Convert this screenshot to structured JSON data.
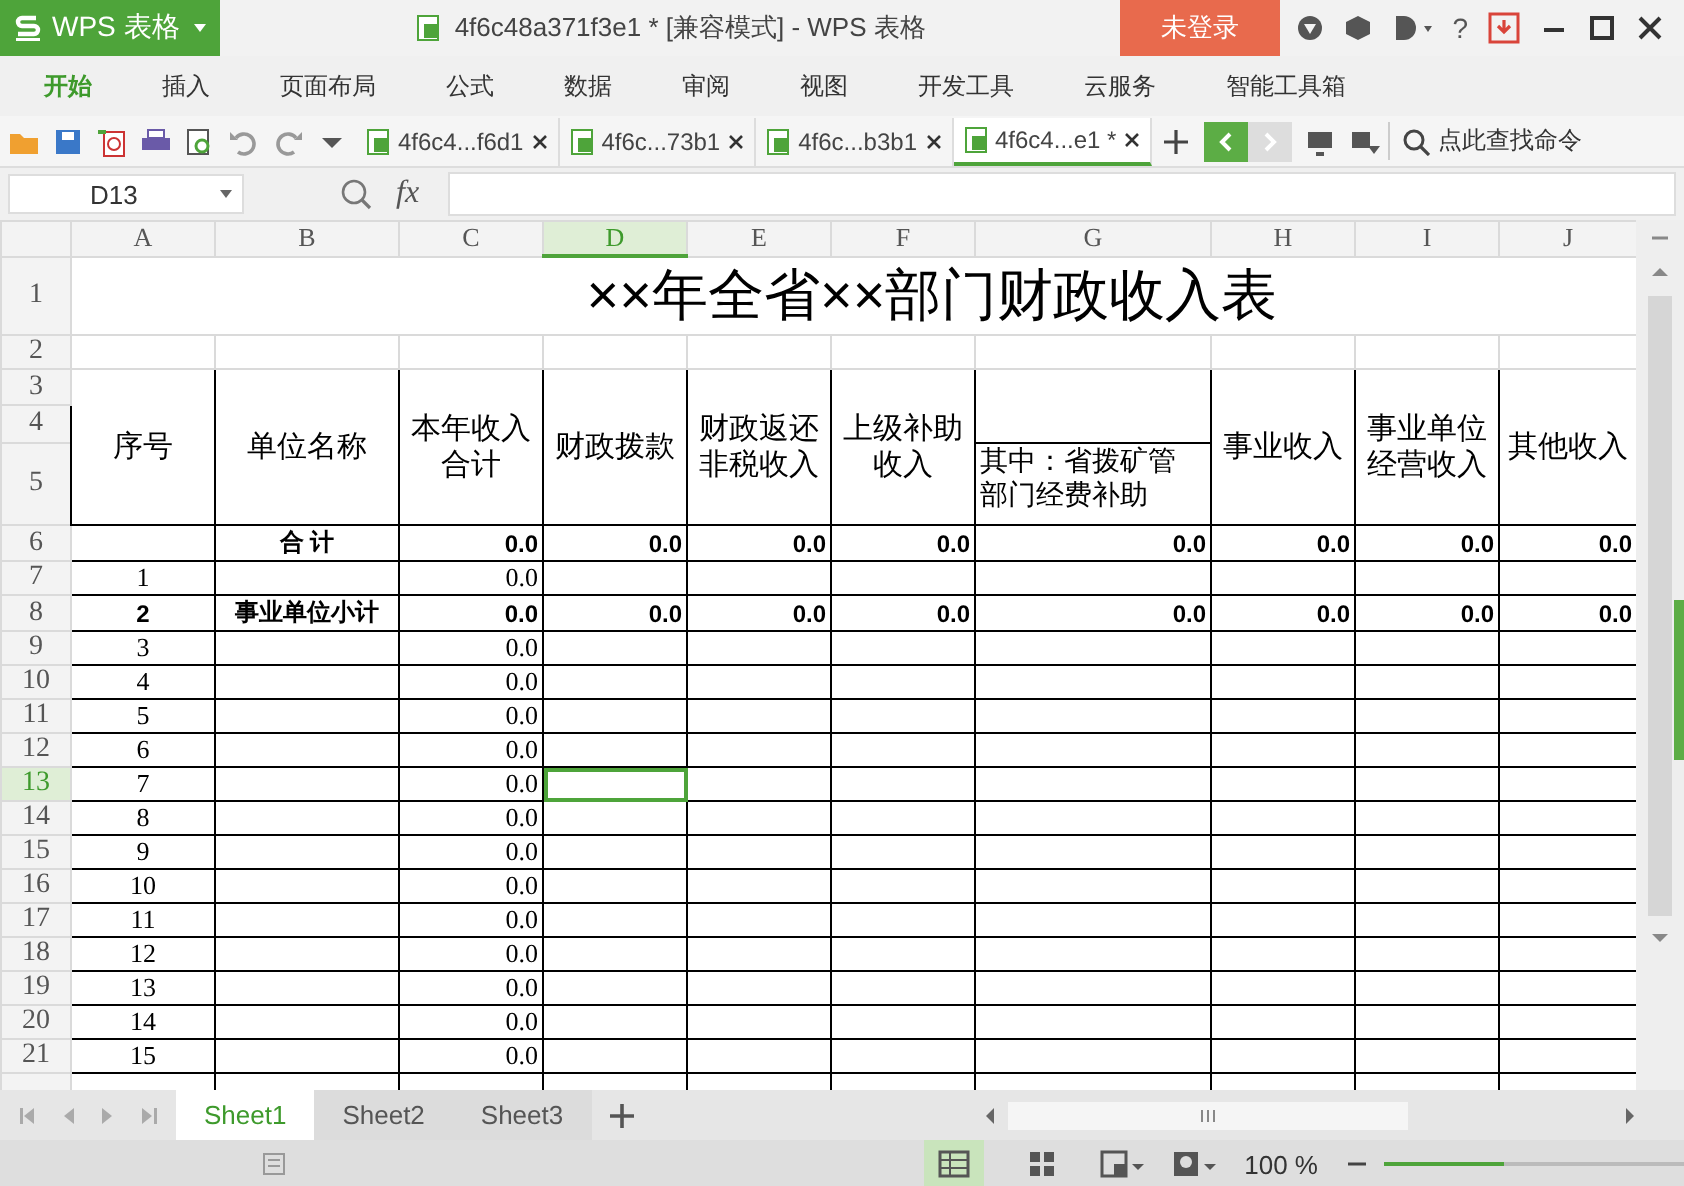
{
  "title_bar": {
    "app_button": "WPS 表格",
    "document_title": "4f6c48a371f3e1 * [兼容模式] - WPS 表格",
    "login_button": "未登录",
    "help": "?"
  },
  "menu": {
    "items": [
      {
        "label": "开始",
        "selected": true
      },
      {
        "label": "插入",
        "selected": false
      },
      {
        "label": "页面布局",
        "selected": false
      },
      {
        "label": "公式",
        "selected": false
      },
      {
        "label": "数据",
        "selected": false
      },
      {
        "label": "审阅",
        "selected": false
      },
      {
        "label": "视图",
        "selected": false
      },
      {
        "label": "开发工具",
        "selected": false
      },
      {
        "label": "云服务",
        "selected": false
      },
      {
        "label": "智能工具箱",
        "selected": false
      }
    ]
  },
  "toolbar": {
    "doc_tabs": [
      {
        "label": "4f6c4...f6d1",
        "selected": false
      },
      {
        "label": "4f6c...73b1",
        "selected": false
      },
      {
        "label": "4f6c...b3b1",
        "selected": false
      },
      {
        "label": "4f6c4...e1 *",
        "selected": true
      }
    ],
    "search": "点此查找命令"
  },
  "formula_bar": {
    "name_box": "D13",
    "fx": "fx"
  },
  "sheet": {
    "title": "××年全省××部门财政收入表",
    "columns": [
      {
        "label": "A",
        "selected": false
      },
      {
        "label": "B",
        "selected": false
      },
      {
        "label": "C",
        "selected": false
      },
      {
        "label": "D",
        "selected": true
      },
      {
        "label": "E",
        "selected": false
      },
      {
        "label": "F",
        "selected": false
      },
      {
        "label": "G",
        "selected": false
      },
      {
        "label": "H",
        "selected": false
      },
      {
        "label": "I",
        "selected": false
      },
      {
        "label": "J",
        "selected": false
      }
    ],
    "header_cells": [
      {
        "kind": "merged",
        "lines": [
          "序号"
        ]
      },
      {
        "kind": "merged",
        "lines": [
          "单位名称"
        ]
      },
      {
        "kind": "merged",
        "lines": [
          "本年收入",
          "合计"
        ]
      },
      {
        "kind": "merged",
        "lines": [
          "财政拨款"
        ]
      },
      {
        "kind": "merged",
        "lines": [
          "财政返还",
          "非税收入"
        ]
      },
      {
        "kind": "merged",
        "lines": [
          "上级补助",
          "收入"
        ]
      },
      {
        "kind": "split",
        "lines": [
          "其中：省拨矿管",
          "部门经费补助"
        ]
      },
      {
        "kind": "merged",
        "lines": [
          "事业收入"
        ]
      },
      {
        "kind": "merged",
        "lines": [
          "事业单位",
          "经营收入"
        ]
      },
      {
        "kind": "merged",
        "lines": [
          "其他收入"
        ]
      }
    ],
    "rows": [
      {
        "label": "1",
        "selected": false
      },
      {
        "label": "2",
        "selected": false
      },
      {
        "label": "3",
        "selected": false
      },
      {
        "label": "4",
        "selected": false
      },
      {
        "label": "5",
        "selected": false
      },
      {
        "label": "6",
        "selected": false,
        "bold": true,
        "cells": [
          null,
          "合 计",
          "0.0",
          "0.0",
          "0.0",
          "0.0",
          "0.0",
          "0.0",
          "0.0",
          "0.0"
        ]
      },
      {
        "label": "7",
        "selected": false,
        "bold": false,
        "cells": [
          "1",
          null,
          "0.0",
          null,
          null,
          null,
          null,
          null,
          null,
          null
        ]
      },
      {
        "label": "8",
        "selected": false,
        "bold": true,
        "cells": [
          "2",
          "事业单位小计",
          "0.0",
          "0.0",
          "0.0",
          "0.0",
          "0.0",
          "0.0",
          "0.0",
          "0.0"
        ]
      },
      {
        "label": "9",
        "selected": false,
        "bold": false,
        "cells": [
          "3",
          null,
          "0.0",
          null,
          null,
          null,
          null,
          null,
          null,
          null
        ]
      },
      {
        "label": "10",
        "selected": false,
        "bold": false,
        "cells": [
          "4",
          null,
          "0.0",
          null,
          null,
          null,
          null,
          null,
          null,
          null
        ]
      },
      {
        "label": "11",
        "selected": false,
        "bold": false,
        "cells": [
          "5",
          null,
          "0.0",
          null,
          null,
          null,
          null,
          null,
          null,
          null
        ]
      },
      {
        "label": "12",
        "selected": false,
        "bold": false,
        "cells": [
          "6",
          null,
          "0.0",
          null,
          null,
          null,
          null,
          null,
          null,
          null
        ]
      },
      {
        "label": "13",
        "selected": true,
        "bold": false,
        "cells": [
          "7",
          null,
          "0.0",
          null,
          null,
          null,
          null,
          null,
          null,
          null
        ]
      },
      {
        "label": "14",
        "selected": false,
        "bold": false,
        "cells": [
          "8",
          null,
          "0.0",
          null,
          null,
          null,
          null,
          null,
          null,
          null
        ]
      },
      {
        "label": "15",
        "selected": false,
        "bold": false,
        "cells": [
          "9",
          null,
          "0.0",
          null,
          null,
          null,
          null,
          null,
          null,
          null
        ]
      },
      {
        "label": "16",
        "selected": false,
        "bold": false,
        "cells": [
          "10",
          null,
          "0.0",
          null,
          null,
          null,
          null,
          null,
          null,
          null
        ]
      },
      {
        "label": "17",
        "selected": false,
        "bold": false,
        "cells": [
          "11",
          null,
          "0.0",
          null,
          null,
          null,
          null,
          null,
          null,
          null
        ]
      },
      {
        "label": "18",
        "selected": false,
        "bold": false,
        "cells": [
          "12",
          null,
          "0.0",
          null,
          null,
          null,
          null,
          null,
          null,
          null
        ]
      },
      {
        "label": "19",
        "selected": false,
        "bold": false,
        "cells": [
          "13",
          null,
          "0.0",
          null,
          null,
          null,
          null,
          null,
          null,
          null
        ]
      },
      {
        "label": "20",
        "selected": false,
        "bold": false,
        "cells": [
          "14",
          null,
          "0.0",
          null,
          null,
          null,
          null,
          null,
          null,
          null
        ]
      },
      {
        "label": "21",
        "selected": false,
        "bold": false,
        "cells": [
          "15",
          null,
          "0.0",
          null,
          null,
          null,
          null,
          null,
          null,
          null
        ]
      }
    ]
  },
  "sheet_tabs": [
    {
      "label": "Sheet1",
      "selected": true
    },
    {
      "label": "Sheet2",
      "selected": false
    },
    {
      "label": "Sheet3",
      "selected": false
    }
  ],
  "status_bar": {
    "zoom": "100 %",
    "zoom_slider": {
      "level": 0.4
    }
  }
}
